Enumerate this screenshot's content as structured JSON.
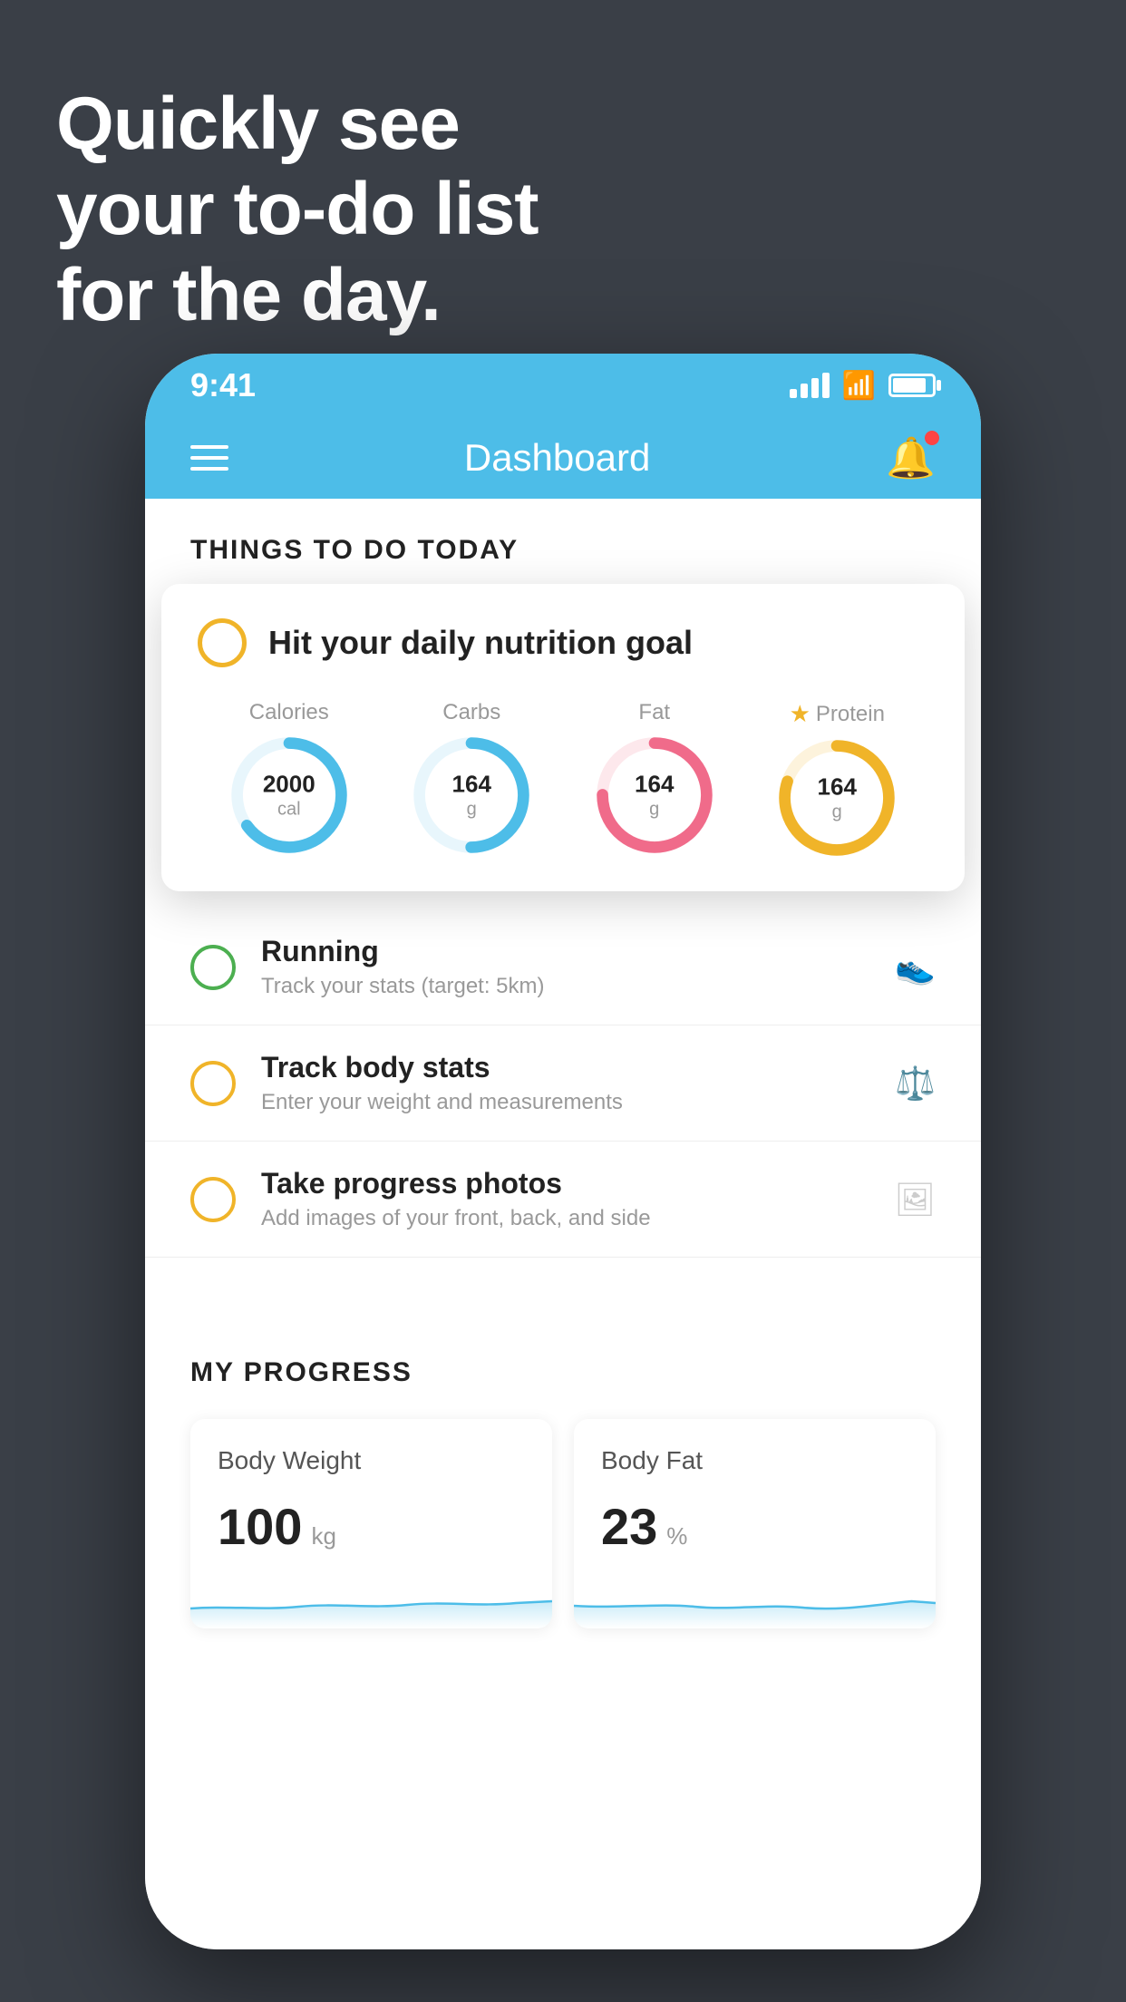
{
  "headline": {
    "line1": "Quickly see",
    "line2": "your to-do list",
    "line3": "for the day."
  },
  "statusBar": {
    "time": "9:41"
  },
  "header": {
    "title": "Dashboard"
  },
  "section1": {
    "label": "THINGS TO DO TODAY"
  },
  "nutritionCard": {
    "title": "Hit your daily nutrition goal",
    "items": [
      {
        "label": "Calories",
        "value": "2000",
        "unit": "cal",
        "color": "#4dbde8",
        "progress": 0.65,
        "hasStar": false
      },
      {
        "label": "Carbs",
        "value": "164",
        "unit": "g",
        "color": "#4dbde8",
        "progress": 0.5,
        "hasStar": false
      },
      {
        "label": "Fat",
        "value": "164",
        "unit": "g",
        "color": "#f06b8a",
        "progress": 0.75,
        "hasStar": false
      },
      {
        "label": "Protein",
        "value": "164",
        "unit": "g",
        "color": "#f0b429",
        "progress": 0.8,
        "hasStar": true
      }
    ]
  },
  "todoItems": [
    {
      "title": "Running",
      "subtitle": "Track your stats (target: 5km)",
      "circleColor": "green",
      "icon": "shoe"
    },
    {
      "title": "Track body stats",
      "subtitle": "Enter your weight and measurements",
      "circleColor": "yellow",
      "icon": "scale"
    },
    {
      "title": "Take progress photos",
      "subtitle": "Add images of your front, back, and side",
      "circleColor": "yellow",
      "icon": "portrait"
    }
  ],
  "progressSection": {
    "title": "MY PROGRESS",
    "cards": [
      {
        "title": "Body Weight",
        "value": "100",
        "unit": "kg"
      },
      {
        "title": "Body Fat",
        "value": "23",
        "unit": "%"
      }
    ]
  }
}
